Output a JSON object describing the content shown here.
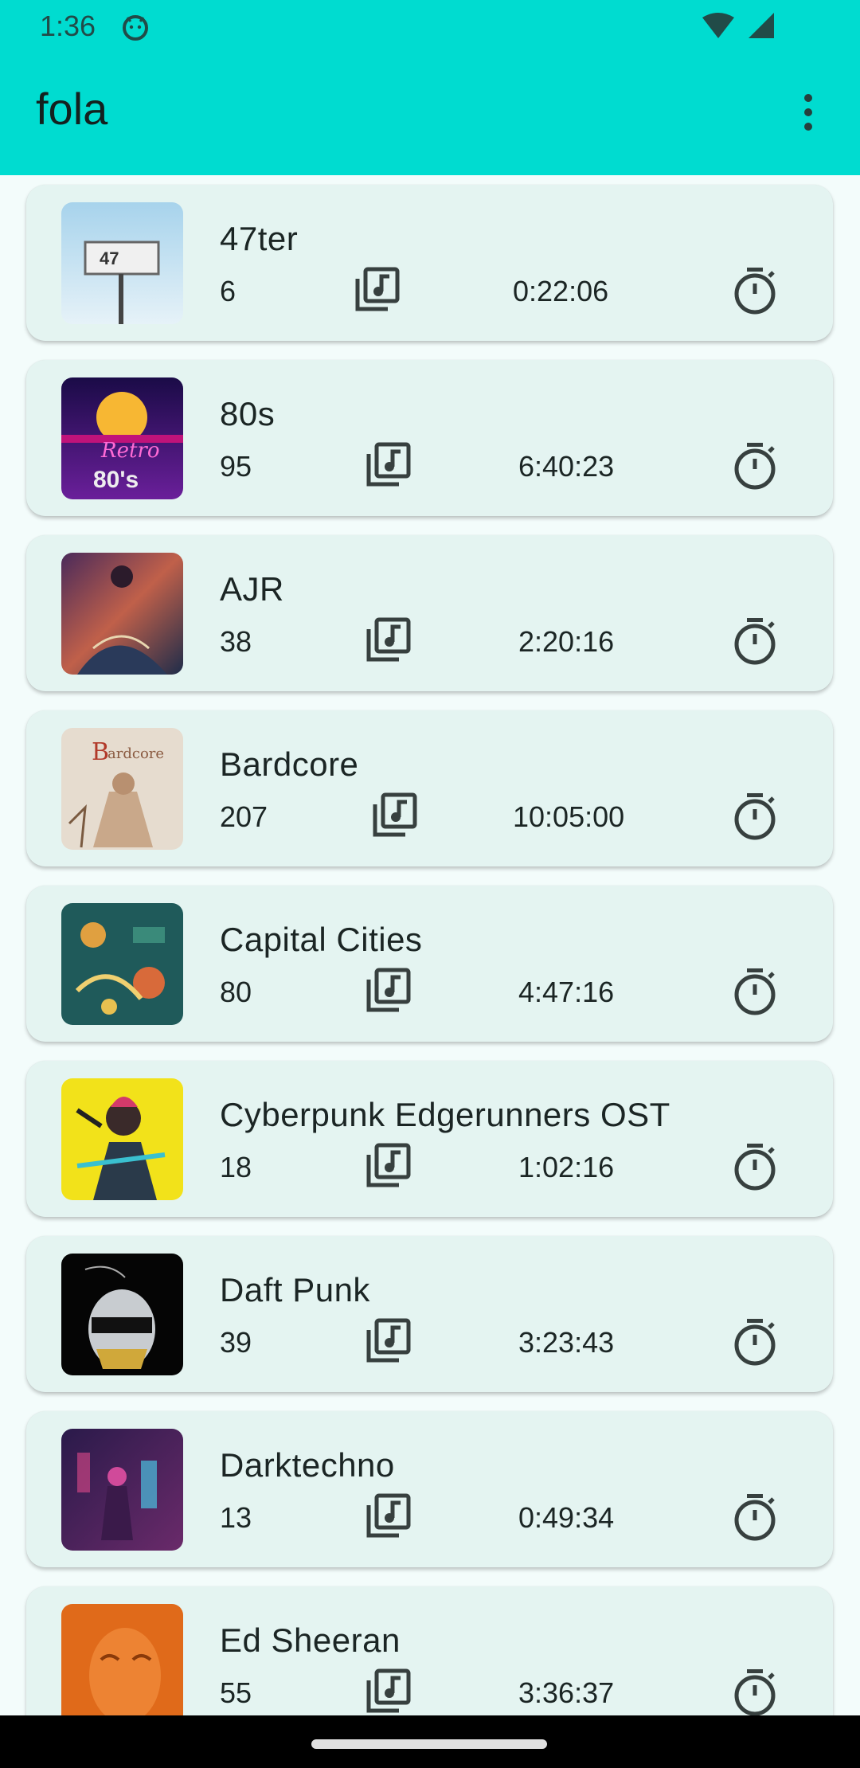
{
  "status": {
    "time": "1:36"
  },
  "app": {
    "title": "fola"
  },
  "playlists": [
    {
      "name": "47ter",
      "count": "6",
      "duration": "0:22:06"
    },
    {
      "name": "80s",
      "count": "95",
      "duration": "6:40:23"
    },
    {
      "name": "AJR",
      "count": "38",
      "duration": "2:20:16"
    },
    {
      "name": "Bardcore",
      "count": "207",
      "duration": "10:05:00"
    },
    {
      "name": "Capital Cities",
      "count": "80",
      "duration": "4:47:16"
    },
    {
      "name": "Cyberpunk Edgerunners OST",
      "count": "18",
      "duration": "1:02:16"
    },
    {
      "name": "Daft Punk",
      "count": "39",
      "duration": "3:23:43"
    },
    {
      "name": "Darktechno",
      "count": "13",
      "duration": "0:49:34"
    },
    {
      "name": "Ed Sheeran",
      "count": "55",
      "duration": "3:36:37"
    }
  ],
  "icons": {
    "songs": "library-music-icon",
    "duration": "timer-icon",
    "menu": "more-vert-icon"
  },
  "colors": {
    "app_bar": "#00dcd0",
    "card": "#e4f4f1",
    "background": "#f3fcfb"
  }
}
